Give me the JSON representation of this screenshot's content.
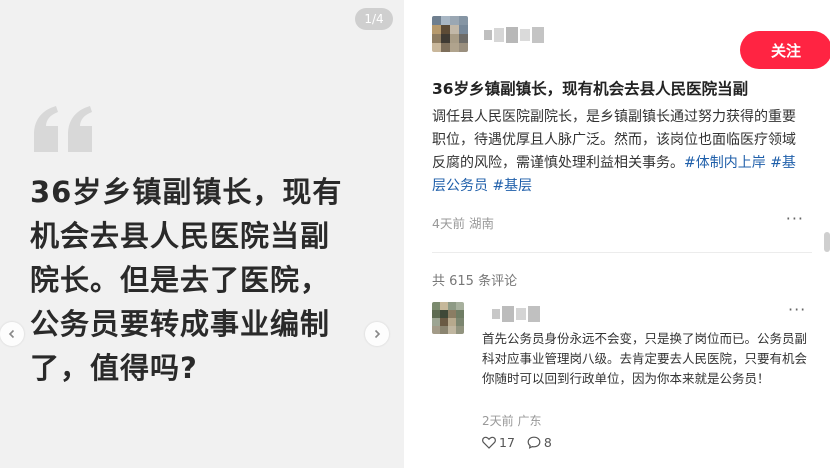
{
  "image": {
    "page_counter": "1/4",
    "text": "36岁乡镇副镇长，现有机会去县人民医院当副院长。但是去了医院，公务员要转成事业编制了，值得吗?"
  },
  "post": {
    "follow_label": "关注",
    "title": "36岁乡镇副镇长，现有机会去县人民医院当副",
    "body": "调任县人民医院副院长，是乡镇副镇长通过努力获得的重要职位，待遇优厚且人脉广泛。然而，该岗位也面临医疗领域反腐的风险，需谨慎处理利益相关事务。",
    "tags": [
      "#体制内上岸",
      "#基层公务员",
      "#基层"
    ],
    "date": "4天前",
    "location": "湖南",
    "more": "···"
  },
  "comments_section": {
    "count_label": "共 615 条评论",
    "comments": [
      {
        "text": "首先公务员身份永远不会变，只是换了岗位而已。公务员副科对应事业管理岗八级。去肯定要去人民医院，只要有机会你随时可以回到行政单位，因为你本来就是公务员！",
        "date": "2天前",
        "location": "广东",
        "likes": "17",
        "replies": "8",
        "more": "···"
      }
    ]
  },
  "colors": {
    "accent": "#ff2442",
    "tag": "#1f5faa"
  },
  "icons": {
    "quote": "quote-icon",
    "prev": "chevron-left-icon",
    "next": "chevron-right-icon",
    "like": "heart-icon",
    "reply": "comment-bubble-icon"
  }
}
